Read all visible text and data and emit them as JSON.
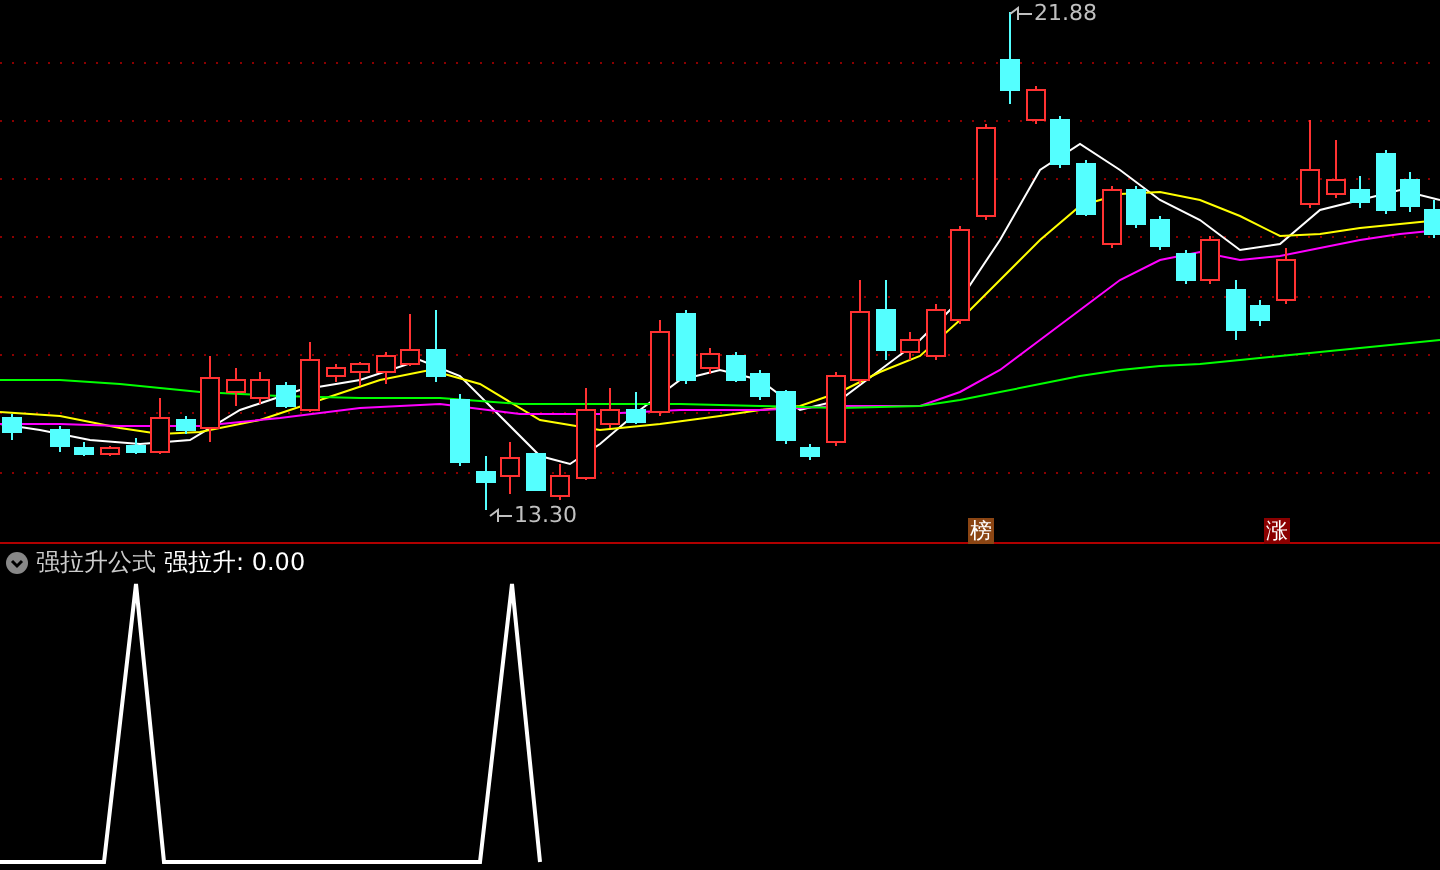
{
  "main_chart": {
    "high_label": "21.88",
    "low_label": "13.30",
    "markers": [
      {
        "text": "榜",
        "color": "#8b4513"
      },
      {
        "text": "涨",
        "color": "#8b0000"
      }
    ]
  },
  "indicator": {
    "title": "强拉升公式",
    "value_label": "强拉升: 0.00"
  }
}
